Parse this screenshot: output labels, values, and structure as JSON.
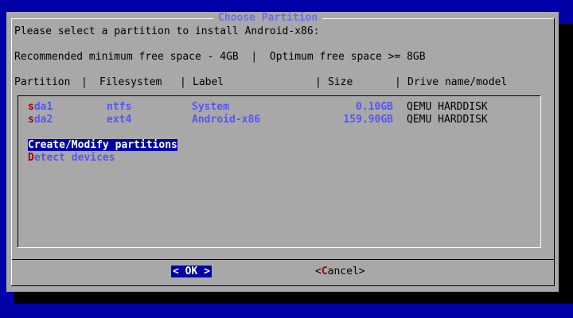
{
  "dialog": {
    "title": "Choose Partition",
    "prompt": "Please select a partition to install Android-x86:",
    "space_info": "Recommended minimum free space - 4GB  |  Optimum free space >= 8GB",
    "columns": {
      "partition": "Partition",
      "filesystem": "Filesystem",
      "label": "Label",
      "size": "Size",
      "drive": "Drive name/model"
    }
  },
  "partitions": [
    {
      "hot": "s",
      "rest": "da1",
      "filesystem": "ntfs",
      "label": "System",
      "size": "0.10GB",
      "drive": "QEMU HARDDISK"
    },
    {
      "hot": "s",
      "rest": "da2",
      "filesystem": "ext4",
      "label": "Android-x86",
      "size": "159.90GB",
      "drive": "QEMU HARDDISK"
    }
  ],
  "actions": [
    {
      "hot": "C",
      "rest": "reate/Modify partitions",
      "selected": true
    },
    {
      "hot": "D",
      "rest": "etect devices",
      "selected": false
    }
  ],
  "buttons": {
    "ok_label": "< OK >",
    "cancel_left": "<",
    "cancel_hot": "C",
    "cancel_rest": "ancel>"
  },
  "colors": {
    "background": "#0000a8",
    "dialog": "#a8a8a8",
    "title": "#6b6bff",
    "hotkey": "#a80000",
    "selection": "#0000a8"
  }
}
